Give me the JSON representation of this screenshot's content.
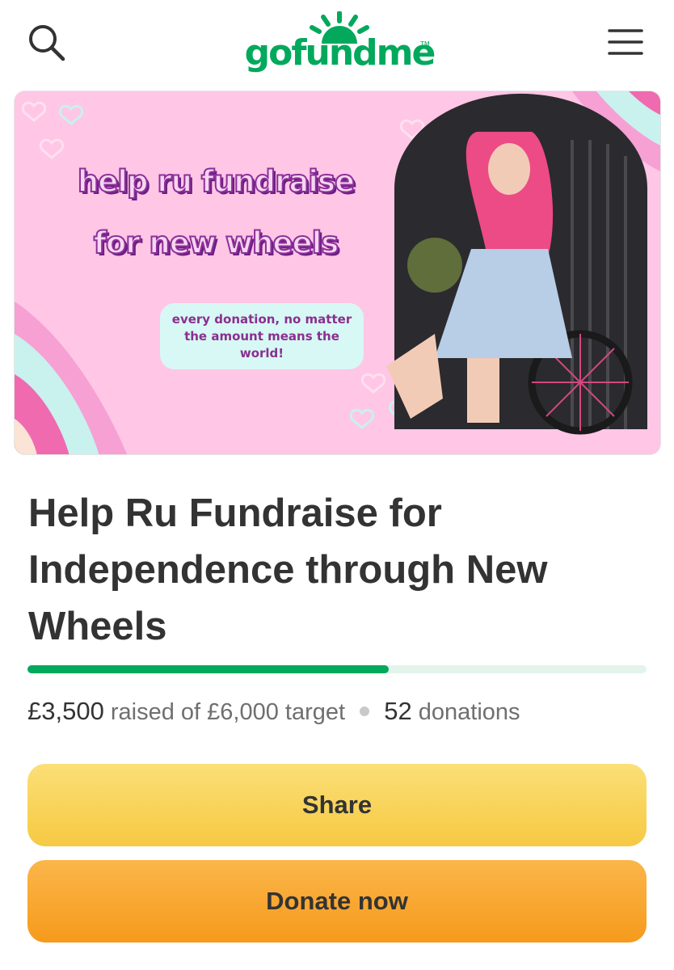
{
  "header": {
    "logo_text": "gofundme",
    "logo_tm": "TM",
    "search_icon": "search-icon",
    "menu_icon": "hamburger-menu-icon"
  },
  "hero": {
    "banner_line1": "help ru fundraise",
    "banner_line2": "for new wheels",
    "note_line1": "every donation, no matter",
    "note_line2": "the amount means the",
    "note_line3": "world!",
    "colors": {
      "background": "#ffc6e6",
      "accent_pink": "#f06ab0",
      "accent_mint": "#c7f4ef"
    }
  },
  "campaign": {
    "title": "Help Ru Fundraise for Independence through New Wheels",
    "progress": 0.583,
    "raised": "£3,500",
    "raised_suffix": "raised of £6,000 target",
    "donations_count": "52",
    "donations_label": "donations"
  },
  "actions": {
    "share_label": "Share",
    "donate_label": "Donate now"
  },
  "colors": {
    "brand_green": "#02a95c",
    "share_button": "#f7cd4f",
    "donate_button": "#f8a22b",
    "text": "#333333"
  }
}
